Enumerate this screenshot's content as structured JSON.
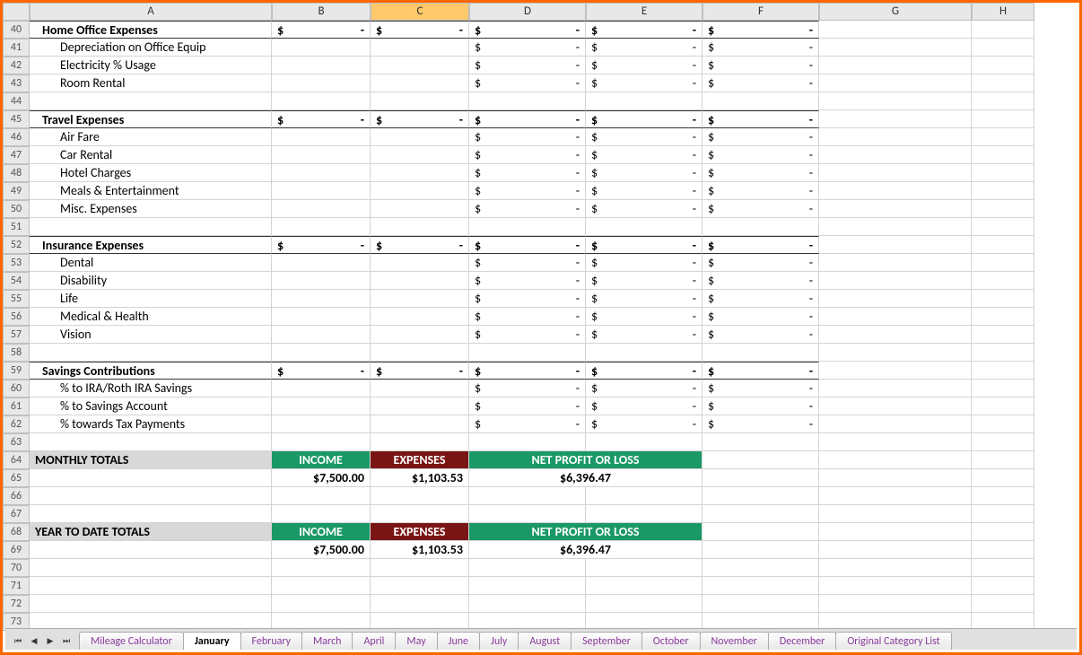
{
  "columns": [
    "A",
    "B",
    "C",
    "D",
    "E",
    "F",
    "G",
    "H"
  ],
  "selectedCol": "C",
  "rows": [
    40,
    41,
    42,
    43,
    44,
    45,
    46,
    47,
    48,
    49,
    50,
    51,
    52,
    53,
    54,
    55,
    56,
    57,
    58,
    59,
    60,
    61,
    62,
    63,
    64,
    65,
    66,
    67,
    68,
    69,
    70,
    71,
    72,
    73
  ],
  "sections": [
    {
      "row": 40,
      "type": "cat",
      "label": "Home Office Expenses",
      "bd": [
        "$  -",
        "$  -",
        "$  -",
        "$  -",
        "$  -"
      ]
    },
    {
      "row": 41,
      "type": "sub",
      "label": "Depreciation on Office Equip",
      "bd": [
        null,
        null,
        "$  -",
        "$  -",
        "$  -"
      ]
    },
    {
      "row": 42,
      "type": "sub",
      "label": "Electricity % Usage",
      "bd": [
        null,
        null,
        "$  -",
        "$  -",
        "$  -"
      ]
    },
    {
      "row": 43,
      "type": "sub",
      "label": "Room Rental",
      "bd": [
        null,
        null,
        "$  -",
        "$  -",
        "$  -"
      ]
    },
    {
      "row": 44,
      "type": "blank"
    },
    {
      "row": 45,
      "type": "cat",
      "label": "Travel Expenses",
      "bd": [
        "$  -",
        "$  -",
        "$  -",
        "$  -",
        "$  -"
      ]
    },
    {
      "row": 46,
      "type": "sub",
      "label": "Air Fare",
      "bd": [
        null,
        null,
        "$  -",
        "$  -",
        "$  -"
      ]
    },
    {
      "row": 47,
      "type": "sub",
      "label": "Car Rental",
      "bd": [
        null,
        null,
        "$  -",
        "$  -",
        "$  -"
      ]
    },
    {
      "row": 48,
      "type": "sub",
      "label": "Hotel Charges",
      "bd": [
        null,
        null,
        "$  -",
        "$  -",
        "$  -"
      ]
    },
    {
      "row": 49,
      "type": "sub",
      "label": "Meals & Entertainment",
      "bd": [
        null,
        null,
        "$  -",
        "$  -",
        "$  -"
      ]
    },
    {
      "row": 50,
      "type": "sub",
      "label": "Misc. Expenses",
      "bd": [
        null,
        null,
        "$  -",
        "$  -",
        "$  -"
      ]
    },
    {
      "row": 51,
      "type": "blank"
    },
    {
      "row": 52,
      "type": "cat",
      "label": "Insurance Expenses",
      "bd": [
        "$  -",
        "$  -",
        "$  -",
        "$  -",
        "$  -"
      ]
    },
    {
      "row": 53,
      "type": "sub",
      "label": "Dental",
      "bd": [
        null,
        null,
        "$  -",
        "$  -",
        "$  -"
      ]
    },
    {
      "row": 54,
      "type": "sub",
      "label": "Disability",
      "bd": [
        null,
        null,
        "$  -",
        "$  -",
        "$  -"
      ]
    },
    {
      "row": 55,
      "type": "sub",
      "label": "Life",
      "bd": [
        null,
        null,
        "$  -",
        "$  -",
        "$  -"
      ]
    },
    {
      "row": 56,
      "type": "sub",
      "label": "Medical & Health",
      "bd": [
        null,
        null,
        "$  -",
        "$  -",
        "$  -"
      ]
    },
    {
      "row": 57,
      "type": "sub",
      "label": "Vision",
      "bd": [
        null,
        null,
        "$  -",
        "$  -",
        "$  -"
      ]
    },
    {
      "row": 58,
      "type": "blank"
    },
    {
      "row": 59,
      "type": "cat",
      "label": "Savings Contributions",
      "bd": [
        "$  -",
        "$  -",
        "$  -",
        "$  -",
        "$  -"
      ]
    },
    {
      "row": 60,
      "type": "sub",
      "label": "% to IRA/Roth IRA Savings",
      "bd": [
        null,
        null,
        "$  -",
        "$  -",
        "$  -"
      ]
    },
    {
      "row": 61,
      "type": "sub",
      "label": "% to Savings Account",
      "bd": [
        null,
        null,
        "$  -",
        "$  -",
        "$  -"
      ]
    },
    {
      "row": 62,
      "type": "sub",
      "label": "% towards Tax Payments",
      "bd": [
        null,
        null,
        "$  -",
        "$  -",
        "$  -"
      ]
    },
    {
      "row": 63,
      "type": "blank"
    },
    {
      "row": 64,
      "type": "totalhdr",
      "label": "MONTHLY TOTALS",
      "b": "INCOME",
      "c": "EXPENSES",
      "de": "NET PROFIT OR LOSS"
    },
    {
      "row": 65,
      "type": "totalval",
      "b": "$7,500.00",
      "c": "$1,103.53",
      "de": "$6,396.47"
    },
    {
      "row": 66,
      "type": "blank"
    },
    {
      "row": 67,
      "type": "blank"
    },
    {
      "row": 68,
      "type": "totalhdr",
      "label": "YEAR TO DATE TOTALS",
      "b": "INCOME",
      "c": "EXPENSES",
      "de": "NET PROFIT OR LOSS"
    },
    {
      "row": 69,
      "type": "totalval",
      "b": "$7,500.00",
      "c": "$1,103.53",
      "de": "$6,396.47"
    },
    {
      "row": 70,
      "type": "blank"
    },
    {
      "row": 71,
      "type": "blank"
    },
    {
      "row": 72,
      "type": "blank"
    },
    {
      "row": 73,
      "type": "blank"
    }
  ],
  "tabs": [
    "Mileage Calculator",
    "January",
    "February",
    "March",
    "April",
    "May",
    "June",
    "July",
    "August",
    "September",
    "October",
    "November",
    "December",
    "Original Category List"
  ],
  "activeTab": "January"
}
